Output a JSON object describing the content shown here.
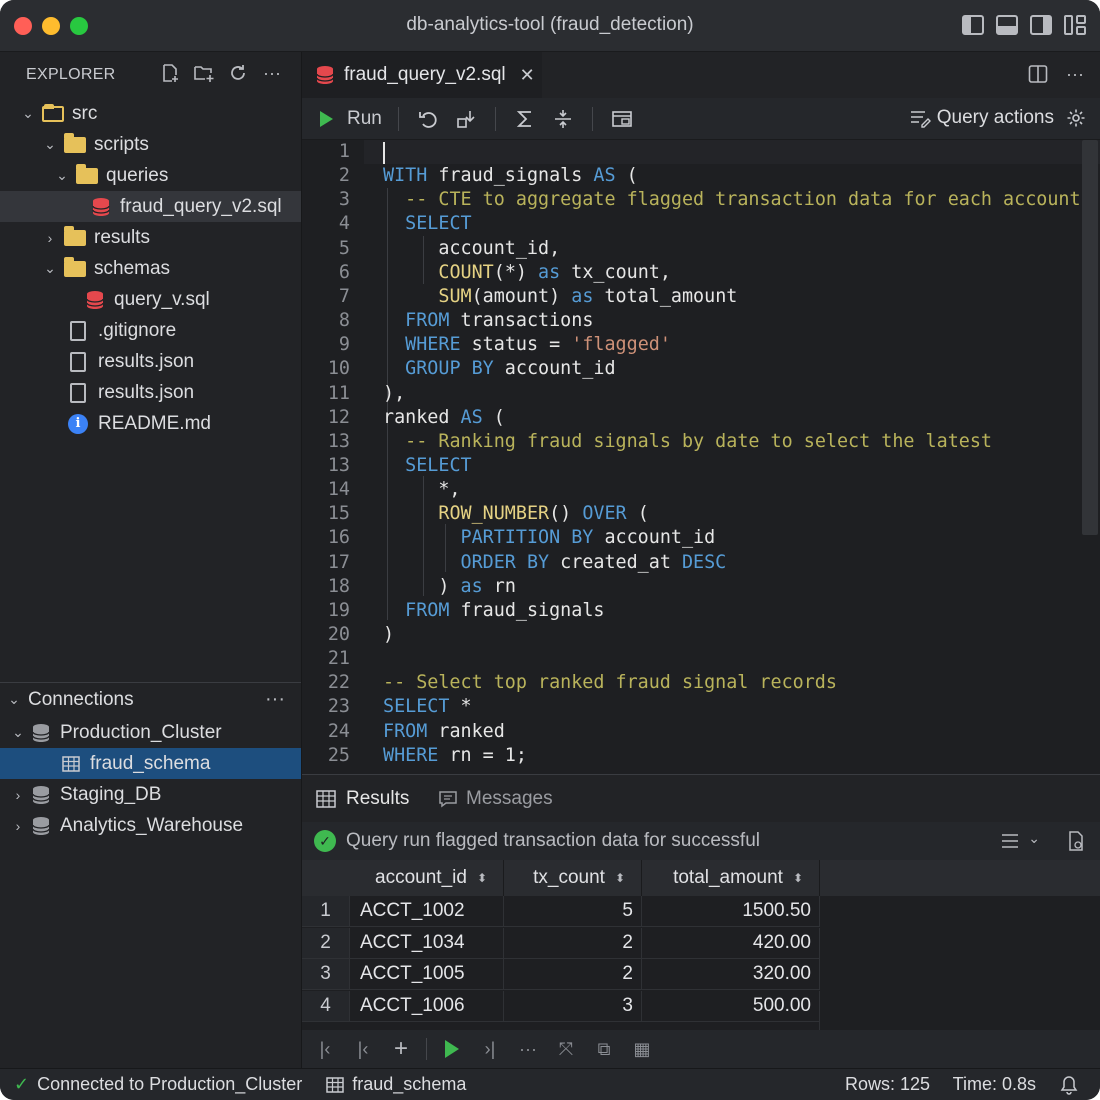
{
  "window": {
    "title": "db-analytics-tool (fraud_detection)"
  },
  "explorer": {
    "header": "EXPLORER",
    "tree": [
      {
        "label": "src"
      },
      {
        "label": "scripts"
      },
      {
        "label": "queries"
      },
      {
        "label": "fraud_query_v2.sql"
      },
      {
        "label": "results"
      },
      {
        "label": "schemas"
      },
      {
        "label": "query_v.sql"
      },
      {
        "label": ".gitignore"
      },
      {
        "label": "results.json"
      },
      {
        "label": "results.json"
      },
      {
        "label": "README.md"
      }
    ]
  },
  "connections": {
    "header": "Connections",
    "items": [
      {
        "label": "Production_Cluster"
      },
      {
        "label": "fraud_schema"
      },
      {
        "label": "Staging_DB"
      },
      {
        "label": "Analytics_Warehouse"
      }
    ]
  },
  "editor": {
    "tab_label": "fraud_query_v2.sql",
    "run_label": "Run",
    "query_actions_label": "Query actions",
    "line_numbers": [
      "1",
      "2",
      "3",
      "4",
      "5",
      "6",
      "7",
      "8",
      "9",
      "10",
      "11",
      "12",
      "13",
      "13",
      "14",
      "15",
      "16",
      "17",
      "18",
      "19",
      "20",
      "21",
      "22",
      "23",
      "24",
      "25"
    ]
  },
  "results": {
    "tab_results": "Results",
    "tab_messages": "Messages",
    "status_message": "Query run flagged transaction data for successful",
    "columns": [
      "account_id",
      "tx_count",
      "total_amount"
    ],
    "rows": [
      {
        "n": "1",
        "account_id": "ACCT_1002",
        "tx_count": "5",
        "total_amount": "1500.50"
      },
      {
        "n": "2",
        "account_id": "ACCT_1034",
        "tx_count": "2",
        "total_amount": "420.00"
      },
      {
        "n": "3",
        "account_id": "ACCT_1005",
        "tx_count": "2",
        "total_amount": "320.00"
      },
      {
        "n": "4",
        "account_id": "ACCT_1006",
        "tx_count": "3",
        "total_amount": "500.00"
      }
    ]
  },
  "statusbar": {
    "connection": "Connected to Production_Cluster",
    "schema": "fraud_schema",
    "rows": "Rows: 125",
    "time": "Time: 0.8s"
  },
  "colors": {
    "accent_blue": "#1d4e7e",
    "success_green": "#3fb950",
    "keyword": "#569cd6",
    "string": "#ce9178",
    "comment": "#b9b35b",
    "function": "#e5d284"
  }
}
